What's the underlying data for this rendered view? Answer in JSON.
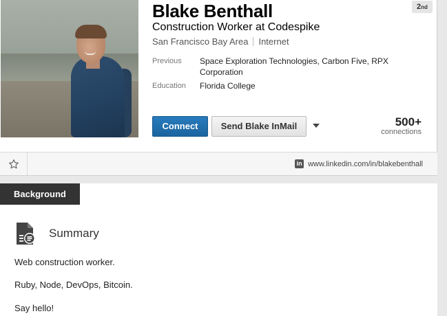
{
  "profile": {
    "name": "Blake Benthall",
    "degree": "2nd",
    "degree_number": "2",
    "degree_suffix": "nd",
    "headline": "Construction Worker at Codespike",
    "location": "San Francisco Bay Area",
    "industry": "Internet",
    "previous_label": "Previous",
    "previous_value": "Space Exploration Technologies, Carbon Five, RPX Corporation",
    "education_label": "Education",
    "education_value": "Florida College",
    "connect_label": "Connect",
    "inmail_label": "Send Blake InMail",
    "connections_count": "500+",
    "connections_label": "connections"
  },
  "toolbar": {
    "url": "www.linkedin.com/in/blakebenthall",
    "li_glyph": "in"
  },
  "background": {
    "tab_label": "Background",
    "summary_title": "Summary",
    "summary_lines": [
      "Web construction worker.",
      "Ruby, Node, DevOps, Bitcoin.",
      "Say hello!"
    ]
  },
  "colors": {
    "connect_blue": "#287bbc",
    "tab_dark": "#333333"
  },
  "icons": {
    "star": "star-icon",
    "linkedin": "linkedin-icon",
    "summary": "summary-document-icon",
    "caret": "chevron-down-icon"
  }
}
